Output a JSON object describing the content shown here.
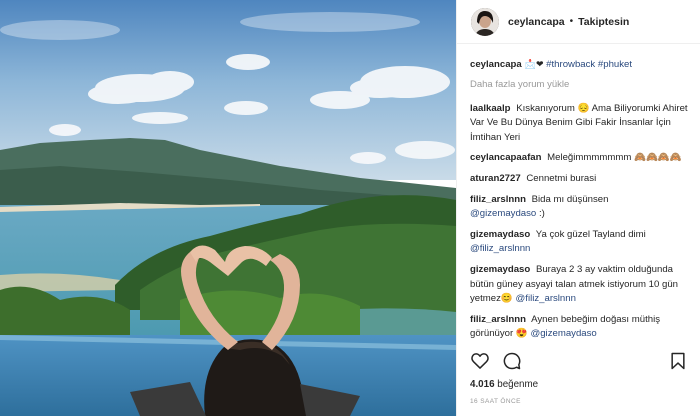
{
  "post": {
    "username": "ceylancapa",
    "separator": "•",
    "follow_state": "Takiptesin"
  },
  "caption": {
    "username": "ceylancapa",
    "emoji": "📩❤",
    "tags": [
      "#throwback",
      "#phuket"
    ]
  },
  "load_more": "Daha fazla yorum yükle",
  "comments": [
    {
      "user": "laalkaalp",
      "text": "Kıskanıyorum 😔 Ama Biliyorumki Ahiret Var Ve Bu Dünya Benim Gibi Fakir İnsanlar İçin İmtihan Yeri"
    },
    {
      "user": "ceylancapaafan",
      "text": "Meleğimmmmmmm 🙈🙈🙈🙈"
    },
    {
      "user": "aturan2727",
      "text": "Cennetmi burasi"
    },
    {
      "user": "filiz_arslnnn",
      "text": "Bida mı düşünsen",
      "mention": "@gizemaydaso",
      "after": " :)"
    },
    {
      "user": "gizemaydaso",
      "text": "Ya çok güzel Tayland dimi",
      "mention": "@filiz_arslnnn",
      "after": ""
    },
    {
      "user": "gizemaydaso",
      "text": "Buraya 2 3 ay vaktim olduğunda bütün güney asyayi talan atmek istiyorum 10 gün yetmez😊",
      "mention": "@filiz_arslnnn",
      "after": ""
    },
    {
      "user": "filiz_arslnnn",
      "text": "Aynen bebeğim doğası müthiş görünüyor 😍",
      "mention": "@gizemaydaso",
      "after": ""
    }
  ],
  "likes": {
    "count": "4.016",
    "label": "beğenme"
  },
  "timestamp": "16 SAAT ÖNCE",
  "icons": {
    "like": "heart-icon",
    "comment": "comment-icon",
    "save": "bookmark-icon"
  },
  "colors": {
    "text": "#262626",
    "muted": "#999999",
    "link": "#2b4a7e",
    "border": "#efefef"
  }
}
